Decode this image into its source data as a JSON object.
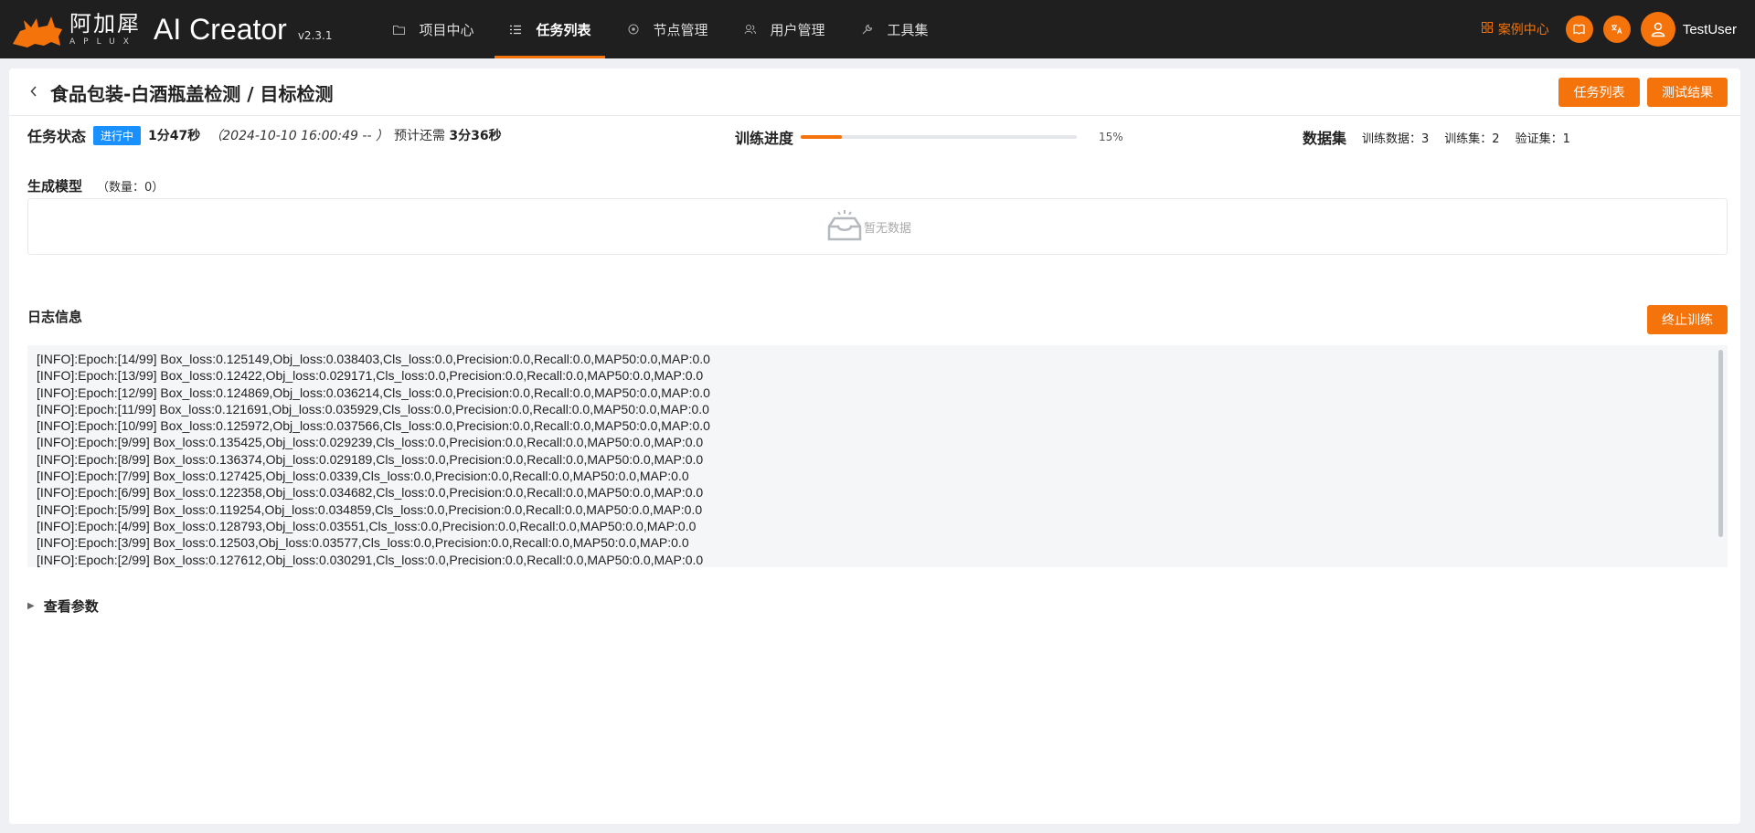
{
  "brand": {
    "name_cn": "阿加犀",
    "name_en": "APLUX",
    "app_title": "AI Creator",
    "version": "v2.3.1"
  },
  "nav": [
    {
      "label": "项目中心",
      "icon": "folder-icon",
      "active": false
    },
    {
      "label": "任务列表",
      "icon": "list-icon",
      "active": true
    },
    {
      "label": "节点管理",
      "icon": "node-icon",
      "active": false
    },
    {
      "label": "用户管理",
      "icon": "users-icon",
      "active": false
    },
    {
      "label": "工具集",
      "icon": "wrench-icon",
      "active": false
    }
  ],
  "topright": {
    "case_center": "案例中心",
    "username": "TestUser"
  },
  "header": {
    "title": "食品包装-白酒瓶盖检测 / 目标检测",
    "btn_task_list": "任务列表",
    "btn_test_result": "测试结果"
  },
  "status": {
    "label": "任务状态",
    "badge": "进行中",
    "duration": "1分47秒",
    "period": "（2024-10-10 16:00:49 -- ）",
    "estimate_label": "预计还需",
    "estimate_value": "3分36秒"
  },
  "progress": {
    "label": "训练进度",
    "value": 0.15,
    "text": "15%"
  },
  "dataset": {
    "label": "数据集",
    "train_data": "训练数据：3",
    "train_set": "训练集：2",
    "val_set": "验证集：1"
  },
  "models": {
    "title": "生成模型",
    "count": "（数量：0）",
    "empty": "暂无数据"
  },
  "log": {
    "title": "日志信息",
    "stop_button": "终止训练",
    "lines": [
      "[INFO]:Epoch:[14/99] Box_loss:0.125149,Obj_loss:0.038403,Cls_loss:0.0,Precision:0.0,Recall:0.0,MAP50:0.0,MAP:0.0",
      "[INFO]:Epoch:[13/99] Box_loss:0.12422,Obj_loss:0.029171,Cls_loss:0.0,Precision:0.0,Recall:0.0,MAP50:0.0,MAP:0.0",
      "[INFO]:Epoch:[12/99] Box_loss:0.124869,Obj_loss:0.036214,Cls_loss:0.0,Precision:0.0,Recall:0.0,MAP50:0.0,MAP:0.0",
      "[INFO]:Epoch:[11/99] Box_loss:0.121691,Obj_loss:0.035929,Cls_loss:0.0,Precision:0.0,Recall:0.0,MAP50:0.0,MAP:0.0",
      "[INFO]:Epoch:[10/99] Box_loss:0.125972,Obj_loss:0.037566,Cls_loss:0.0,Precision:0.0,Recall:0.0,MAP50:0.0,MAP:0.0",
      "[INFO]:Epoch:[9/99] Box_loss:0.135425,Obj_loss:0.029239,Cls_loss:0.0,Precision:0.0,Recall:0.0,MAP50:0.0,MAP:0.0",
      "[INFO]:Epoch:[8/99] Box_loss:0.136374,Obj_loss:0.029189,Cls_loss:0.0,Precision:0.0,Recall:0.0,MAP50:0.0,MAP:0.0",
      "[INFO]:Epoch:[7/99] Box_loss:0.127425,Obj_loss:0.0339,Cls_loss:0.0,Precision:0.0,Recall:0.0,MAP50:0.0,MAP:0.0",
      "[INFO]:Epoch:[6/99] Box_loss:0.122358,Obj_loss:0.034682,Cls_loss:0.0,Precision:0.0,Recall:0.0,MAP50:0.0,MAP:0.0",
      "[INFO]:Epoch:[5/99] Box_loss:0.119254,Obj_loss:0.034859,Cls_loss:0.0,Precision:0.0,Recall:0.0,MAP50:0.0,MAP:0.0",
      "[INFO]:Epoch:[4/99] Box_loss:0.128793,Obj_loss:0.03551,Cls_loss:0.0,Precision:0.0,Recall:0.0,MAP50:0.0,MAP:0.0",
      "[INFO]:Epoch:[3/99] Box_loss:0.12503,Obj_loss:0.03577,Cls_loss:0.0,Precision:0.0,Recall:0.0,MAP50:0.0,MAP:0.0",
      "[INFO]:Epoch:[2/99] Box_loss:0.127612,Obj_loss:0.030291,Cls_loss:0.0,Precision:0.0,Recall:0.0,MAP50:0.0,MAP:0.0"
    ]
  },
  "params": {
    "label": "查看参数"
  },
  "colors": {
    "accent": "#f5730b",
    "topbar": "#1f1f1f",
    "badge": "#1890ff"
  }
}
